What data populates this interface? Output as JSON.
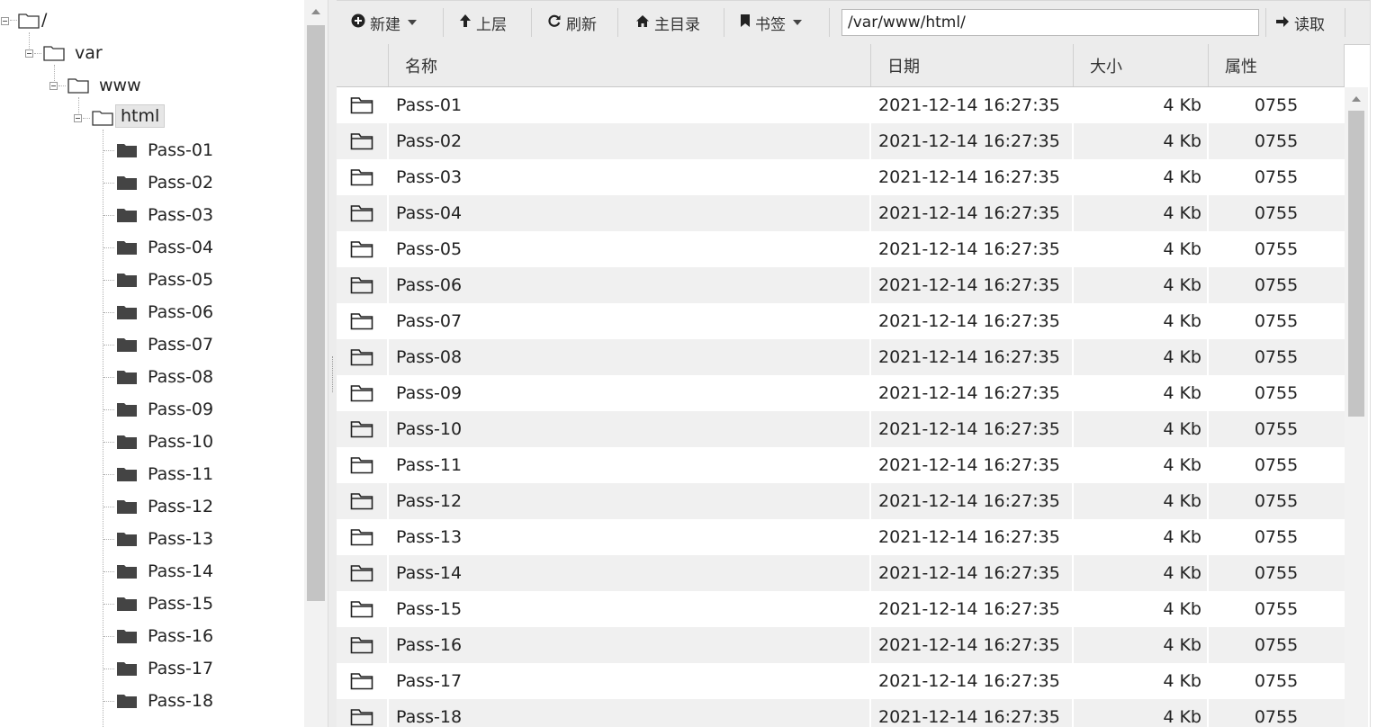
{
  "tree": {
    "root": "/",
    "var": "var",
    "www": "www",
    "html": "html",
    "children": [
      "Pass-01",
      "Pass-02",
      "Pass-03",
      "Pass-04",
      "Pass-05",
      "Pass-06",
      "Pass-07",
      "Pass-08",
      "Pass-09",
      "Pass-10",
      "Pass-11",
      "Pass-12",
      "Pass-13",
      "Pass-14",
      "Pass-15",
      "Pass-16",
      "Pass-17",
      "Pass-18"
    ]
  },
  "toolbar": {
    "new_label": "新建",
    "up_label": "上层",
    "refresh_label": "刷新",
    "home_label": "主目录",
    "bookmark_label": "书签",
    "path_value": "/var/www/html/",
    "read_label": "读取"
  },
  "table": {
    "headers": {
      "name": "名称",
      "date": "日期",
      "size": "大小",
      "perm": "属性"
    },
    "rows": [
      {
        "name": "Pass-01",
        "date": "2021-12-14 16:27:35",
        "size": "4 Kb",
        "perm": "0755"
      },
      {
        "name": "Pass-02",
        "date": "2021-12-14 16:27:35",
        "size": "4 Kb",
        "perm": "0755"
      },
      {
        "name": "Pass-03",
        "date": "2021-12-14 16:27:35",
        "size": "4 Kb",
        "perm": "0755"
      },
      {
        "name": "Pass-04",
        "date": "2021-12-14 16:27:35",
        "size": "4 Kb",
        "perm": "0755"
      },
      {
        "name": "Pass-05",
        "date": "2021-12-14 16:27:35",
        "size": "4 Kb",
        "perm": "0755"
      },
      {
        "name": "Pass-06",
        "date": "2021-12-14 16:27:35",
        "size": "4 Kb",
        "perm": "0755"
      },
      {
        "name": "Pass-07",
        "date": "2021-12-14 16:27:35",
        "size": "4 Kb",
        "perm": "0755"
      },
      {
        "name": "Pass-08",
        "date": "2021-12-14 16:27:35",
        "size": "4 Kb",
        "perm": "0755"
      },
      {
        "name": "Pass-09",
        "date": "2021-12-14 16:27:35",
        "size": "4 Kb",
        "perm": "0755"
      },
      {
        "name": "Pass-10",
        "date": "2021-12-14 16:27:35",
        "size": "4 Kb",
        "perm": "0755"
      },
      {
        "name": "Pass-11",
        "date": "2021-12-14 16:27:35",
        "size": "4 Kb",
        "perm": "0755"
      },
      {
        "name": "Pass-12",
        "date": "2021-12-14 16:27:35",
        "size": "4 Kb",
        "perm": "0755"
      },
      {
        "name": "Pass-13",
        "date": "2021-12-14 16:27:35",
        "size": "4 Kb",
        "perm": "0755"
      },
      {
        "name": "Pass-14",
        "date": "2021-12-14 16:27:35",
        "size": "4 Kb",
        "perm": "0755"
      },
      {
        "name": "Pass-15",
        "date": "2021-12-14 16:27:35",
        "size": "4 Kb",
        "perm": "0755"
      },
      {
        "name": "Pass-16",
        "date": "2021-12-14 16:27:35",
        "size": "4 Kb",
        "perm": "0755"
      },
      {
        "name": "Pass-17",
        "date": "2021-12-14 16:27:35",
        "size": "4 Kb",
        "perm": "0755"
      },
      {
        "name": "Pass-18",
        "date": "2021-12-14 16:27:35",
        "size": "4 Kb",
        "perm": "0755"
      }
    ]
  },
  "icons": {
    "tree_collapse": "collapse-icon",
    "folder_outline": "folder-icon",
    "folder_filled": "folder-filled-icon",
    "new": "plus-circle-icon",
    "up": "arrow-up-icon",
    "refresh": "refresh-icon",
    "home": "home-icon",
    "bookmark": "bookmark-icon",
    "read": "arrow-right-icon"
  },
  "colors": {
    "toolbar_bg": "#ececec",
    "row_alt_bg": "#f0f0f0",
    "selected_bg": "#e6e6e6",
    "scroll_thumb": "#c4c4c4"
  }
}
